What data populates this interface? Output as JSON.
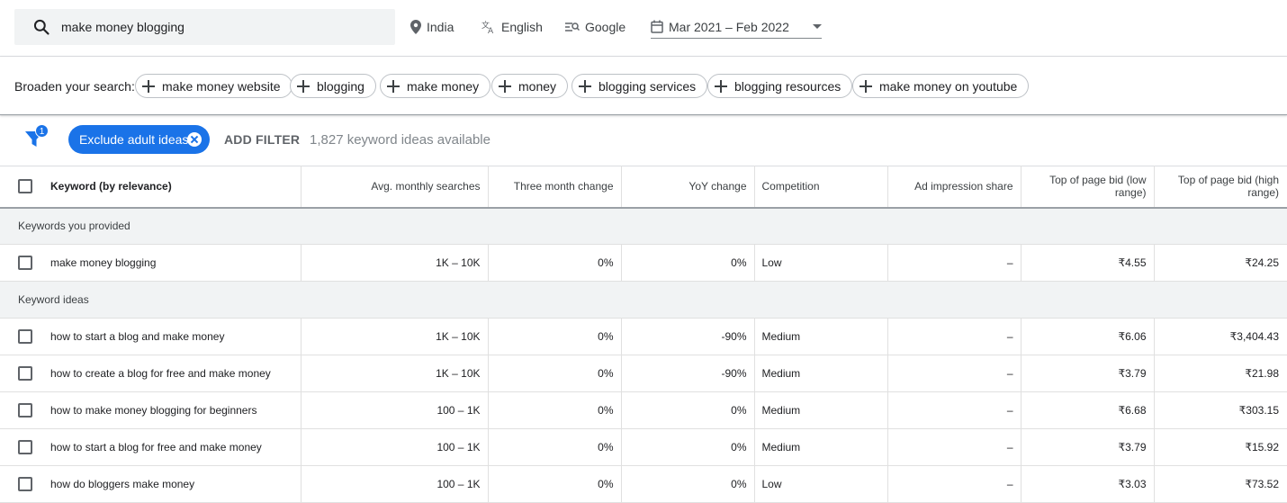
{
  "search": {
    "value": "make money blogging"
  },
  "topbar": {
    "location": "India",
    "language": "English",
    "network": "Google",
    "date_range": "Mar 2021 – Feb 2022"
  },
  "broaden": {
    "label": "Broaden your search:",
    "chips": [
      "make money website",
      "blogging",
      "make money",
      "money",
      "blogging services",
      "blogging resources",
      "make money on youtube"
    ]
  },
  "filters": {
    "badge_count": "1",
    "exclude_chip": "Exclude adult ideas",
    "add_filter": "ADD FILTER",
    "ideas_count": "1,827 keyword ideas available"
  },
  "table": {
    "headers": {
      "keyword": "Keyword (by relevance)",
      "avg_monthly": "Avg. monthly searches",
      "three_month": "Three month change",
      "yoy": "YoY change",
      "competition": "Competition",
      "ad_share": "Ad impression share",
      "bid_low": "Top of page bid (low range)",
      "bid_high": "Top of page bid (high range)"
    },
    "group_provided": "Keywords you provided",
    "group_ideas": "Keyword ideas",
    "provided": [
      {
        "keyword": "make money blogging",
        "avg": "1K – 10K",
        "three": "0%",
        "yoy": "0%",
        "comp": "Low",
        "share": "–",
        "low": "₹4.55",
        "high": "₹24.25"
      }
    ],
    "ideas": [
      {
        "keyword": "how to start a blog and make money",
        "avg": "1K – 10K",
        "three": "0%",
        "yoy": "-90%",
        "comp": "Medium",
        "share": "–",
        "low": "₹6.06",
        "high": "₹3,404.43"
      },
      {
        "keyword": "how to create a blog for free and make money",
        "avg": "1K – 10K",
        "three": "0%",
        "yoy": "-90%",
        "comp": "Medium",
        "share": "–",
        "low": "₹3.79",
        "high": "₹21.98"
      },
      {
        "keyword": "how to make money blogging for beginners",
        "avg": "100 – 1K",
        "three": "0%",
        "yoy": "0%",
        "comp": "Medium",
        "share": "–",
        "low": "₹6.68",
        "high": "₹303.15"
      },
      {
        "keyword": "how to start a blog for free and make money",
        "avg": "100 – 1K",
        "three": "0%",
        "yoy": "0%",
        "comp": "Medium",
        "share": "–",
        "low": "₹3.79",
        "high": "₹15.92"
      },
      {
        "keyword": "how do bloggers make money",
        "avg": "100 – 1K",
        "three": "0%",
        "yoy": "0%",
        "comp": "Low",
        "share": "–",
        "low": "₹3.03",
        "high": "₹73.52"
      }
    ]
  }
}
